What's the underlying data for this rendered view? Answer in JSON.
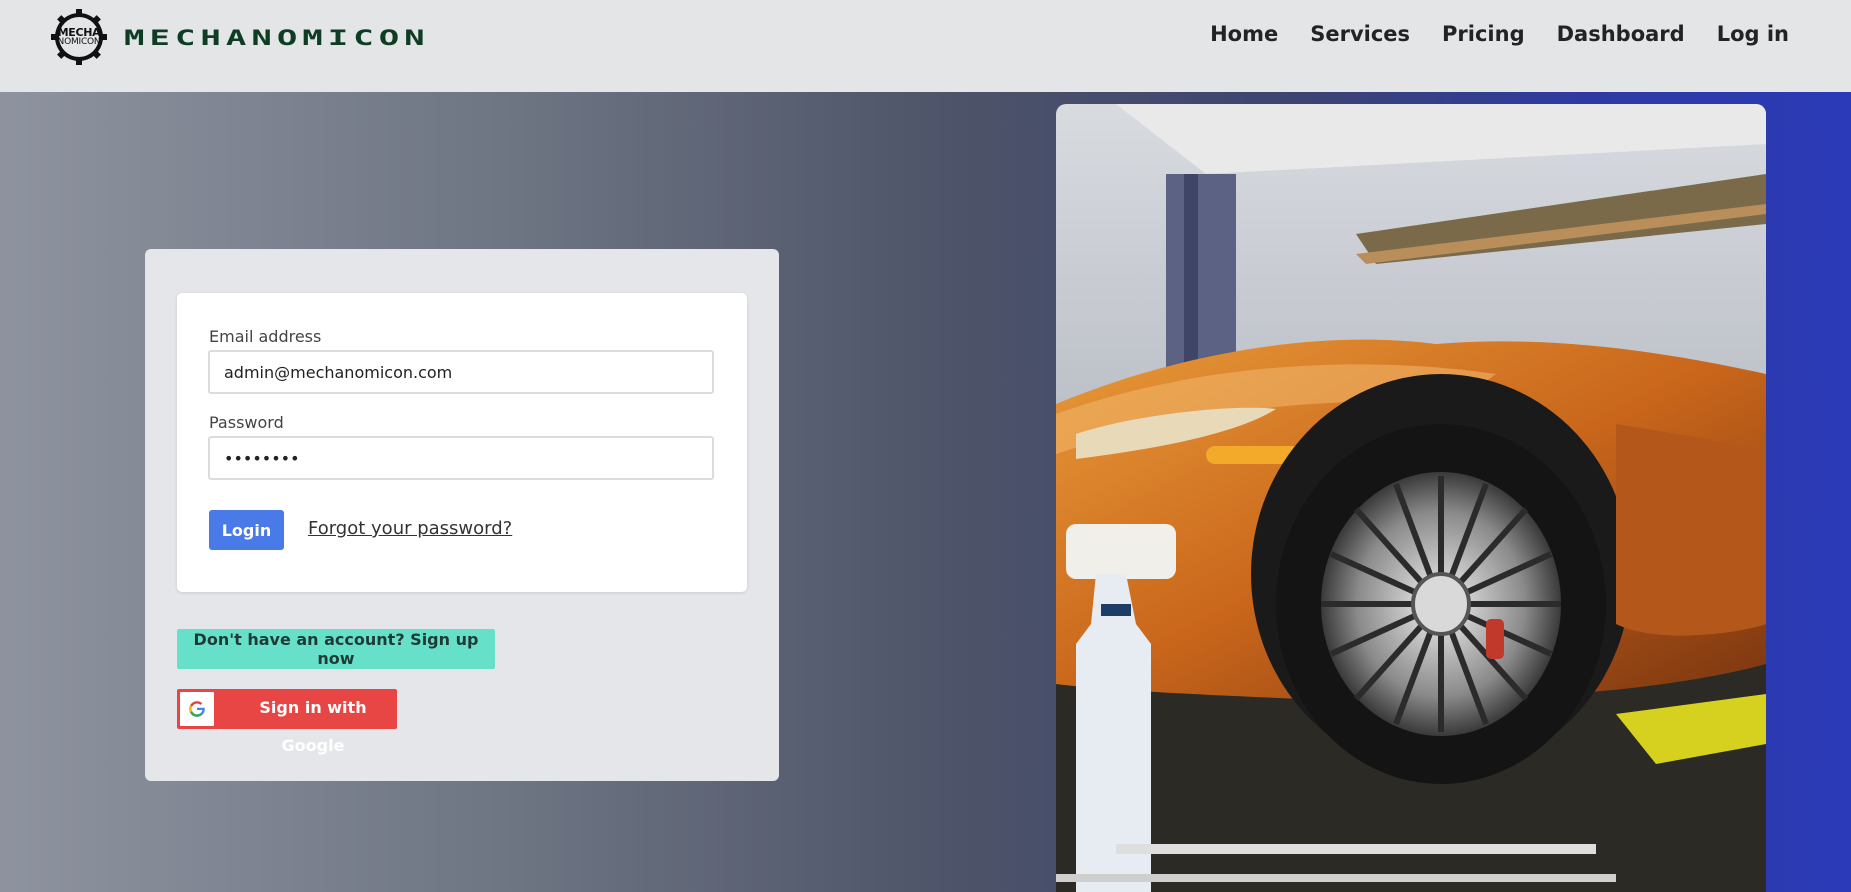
{
  "header": {
    "logo_top": "MECHA",
    "logo_bottom": "NOMICON",
    "brand_name": "MECHANOMICON",
    "nav": [
      "Home",
      "Services",
      "Pricing",
      "Dashboard",
      "Log in"
    ]
  },
  "login_form": {
    "email_label": "Email address",
    "email_value": "admin@mechanomicon.com",
    "password_label": "Password",
    "password_value": "••••••••",
    "login_button": "Login",
    "forgot_link": "Forgot your password?",
    "signup_button": "Don't have an account? Sign up now",
    "google_button": "Sign in with Google",
    "google_icon_letter": "G"
  },
  "photo": {
    "subject": "orange-sports-car-on-lift"
  },
  "colors": {
    "header_bg": "#e4e5e7",
    "login_button": "#4a7ae8",
    "signup_button": "#67e0c9",
    "google_button": "#e84545",
    "brand_text": "#0f3d24"
  }
}
